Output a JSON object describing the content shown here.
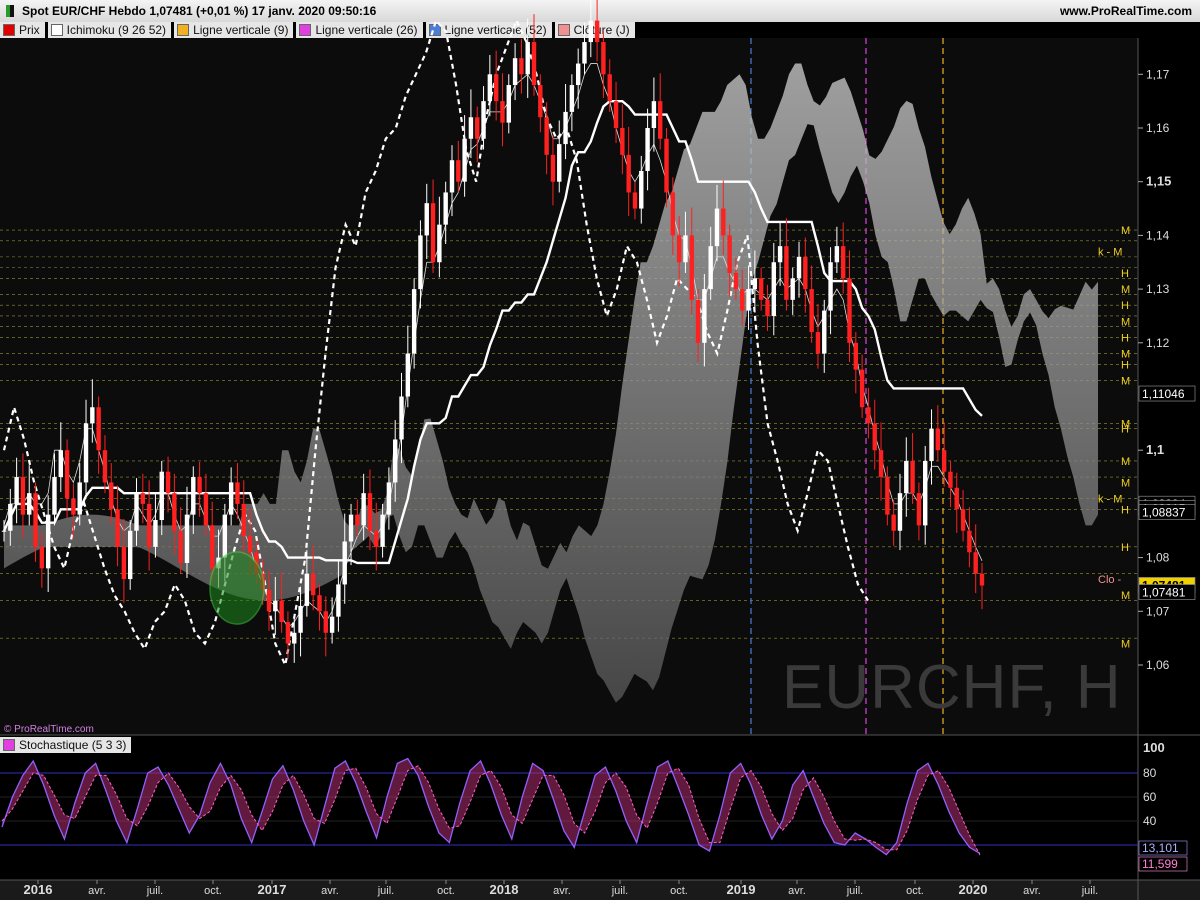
{
  "window": {
    "title": "Spot EUR/CHF Hebdo 1,07481 (+0,01 %) 17 janv. 2020 09:50:16",
    "site": "www.ProRealTime.com",
    "credit": "© ProRealTime.com",
    "watermark": "EURCHF, H"
  },
  "legend": [
    {
      "label": "Prix",
      "color": "#e00000"
    },
    {
      "label": "Ichimoku (9 26 52)",
      "color": "#ffffff"
    },
    {
      "label": "Ligne verticale (9)",
      "color": "#f0b020"
    },
    {
      "label": "Ligne verticale (26)",
      "color": "#e040e0"
    },
    {
      "label": "Ligne verticale (52)",
      "color": "#4a7fd8"
    },
    {
      "label": "Clôture (J)",
      "color": "#f09090"
    }
  ],
  "stoch_legend": {
    "label": "Stochastique (5 3 3)",
    "color": "#e040e0"
  },
  "chart_data": [
    {
      "type": "line",
      "title": "",
      "x": [
        "2016",
        "avr.",
        "juil.",
        "oct.",
        "2017",
        "avr.",
        "juil.",
        "oct.",
        "2018",
        "avr.",
        "juil.",
        "oct.",
        "2019",
        "avr.",
        "juil.",
        "oct.",
        "2020",
        "avr.",
        "juil."
      ],
      "ylim": [
        1.05,
        1.18
      ],
      "yticks": [
        "1,17",
        "1,16",
        "1,15",
        "1,14",
        "1,13",
        "1,12",
        "1,11046",
        "1,1",
        "1,08994",
        "1,08915",
        "1,08837",
        "1,08",
        "1,07481",
        "1,07",
        "1,06"
      ],
      "last_price": "1,07481",
      "series": [
        {
          "name": "Prix",
          "values": [
            1.085,
            1.09,
            1.095,
            1.088,
            1.092,
            1.082,
            1.078,
            1.088,
            1.095,
            1.1,
            1.091,
            1.088,
            1.094,
            1.105,
            1.108,
            1.1,
            1.094,
            1.089,
            1.082,
            1.076,
            1.085,
            1.092,
            1.09,
            1.082,
            1.087,
            1.096,
            1.092,
            1.085,
            1.079,
            1.088,
            1.095,
            1.092,
            1.086,
            1.078,
            1.08,
            1.088,
            1.094,
            1.09,
            1.084,
            1.081,
            1.077,
            1.074,
            1.07,
            1.072,
            1.068,
            1.064,
            1.066,
            1.071,
            1.077,
            1.073,
            1.07,
            1.066,
            1.069,
            1.075,
            1.083,
            1.088,
            1.086,
            1.092,
            1.085,
            1.082,
            1.088,
            1.094,
            1.102,
            1.11,
            1.118,
            1.13,
            1.14,
            1.146,
            1.135,
            1.142,
            1.148,
            1.154,
            1.15,
            1.158,
            1.162,
            1.158,
            1.165,
            1.17,
            1.165,
            1.161,
            1.168,
            1.173,
            1.17,
            1.176,
            1.168,
            1.162,
            1.155,
            1.15,
            1.157,
            1.163,
            1.168,
            1.172,
            1.176,
            1.18,
            1.176,
            1.17,
            1.165,
            1.16,
            1.155,
            1.148,
            1.145,
            1.152,
            1.16,
            1.165,
            1.158,
            1.148,
            1.14,
            1.135,
            1.14,
            1.128,
            1.12,
            1.13,
            1.138,
            1.145,
            1.14,
            1.133,
            1.13,
            1.126,
            1.13,
            1.132,
            1.128,
            1.125,
            1.135,
            1.138,
            1.128,
            1.132,
            1.136,
            1.13,
            1.122,
            1.118,
            1.126,
            1.135,
            1.138,
            1.132,
            1.12,
            1.115,
            1.108,
            1.105,
            1.1,
            1.095,
            1.088,
            1.085,
            1.092,
            1.098,
            1.092,
            1.086,
            1.098,
            1.104,
            1.1,
            1.096,
            1.093,
            1.089,
            1.085,
            1.081,
            1.077,
            1.0748
          ]
        },
        {
          "name": "Tenkan",
          "values": [
            1.086,
            1.09,
            1.09,
            1.09,
            1.092,
            1.09,
            1.09,
            1.092,
            1.1,
            1.1,
            1.096,
            1.094,
            1.098,
            1.104,
            1.104,
            1.1,
            1.096,
            1.091,
            1.087,
            1.085,
            1.086,
            1.09,
            1.088,
            1.086,
            1.088,
            1.092,
            1.092,
            1.088,
            1.085,
            1.086,
            1.09,
            1.09,
            1.087,
            1.084,
            1.084,
            1.087,
            1.09,
            1.088,
            1.085,
            1.082,
            1.078,
            1.075,
            1.072,
            1.071,
            1.069,
            1.067,
            1.068,
            1.07,
            1.072,
            1.071,
            1.07,
            1.068,
            1.07,
            1.074,
            1.078,
            1.081,
            1.084,
            1.086,
            1.085,
            1.084,
            1.086,
            1.09,
            1.096,
            1.103,
            1.112,
            1.12,
            1.128,
            1.135,
            1.135,
            1.138,
            1.142,
            1.146,
            1.148,
            1.152,
            1.156,
            1.157,
            1.16,
            1.163,
            1.163,
            1.163,
            1.165,
            1.168,
            1.169,
            1.17,
            1.168,
            1.165,
            1.162,
            1.158,
            1.158,
            1.16,
            1.163,
            1.166,
            1.17,
            1.172,
            1.172,
            1.168,
            1.165,
            1.16,
            1.156,
            1.152,
            1.15,
            1.152,
            1.155,
            1.157,
            1.154,
            1.15,
            1.144,
            1.14,
            1.139,
            1.134,
            1.128,
            1.128,
            1.132,
            1.136,
            1.136,
            1.133,
            1.131,
            1.129,
            1.13,
            1.13,
            1.129,
            1.128,
            1.13,
            1.132,
            1.13,
            1.131,
            1.132,
            1.13,
            1.126,
            1.123,
            1.125,
            1.128,
            1.13,
            1.128,
            1.122,
            1.118,
            1.112,
            1.108,
            1.103,
            1.099,
            1.094,
            1.09,
            1.09,
            1.092,
            1.092,
            1.09,
            1.093,
            1.097,
            1.097,
            1.095,
            1.093,
            1.091,
            1.088,
            1.085,
            1.082,
            1.0794
          ]
        },
        {
          "name": "Chikou",
          "values": [
            1.1,
            1.108,
            1.102,
            1.094,
            1.088,
            1.082,
            1.078,
            1.086,
            1.09,
            1.084,
            1.078,
            1.073,
            1.07,
            1.066,
            1.063,
            1.068,
            1.07,
            1.075,
            1.072,
            1.066,
            1.064,
            1.068,
            1.075,
            1.082,
            1.088,
            1.085,
            1.075,
            1.064,
            1.06,
            1.07,
            1.08,
            1.1,
            1.118,
            1.134,
            1.142,
            1.138,
            1.148,
            1.152,
            1.158,
            1.16,
            1.166,
            1.17,
            1.174,
            1.18,
            1.178,
            1.168,
            1.156,
            1.15,
            1.162,
            1.17,
            1.175,
            1.18,
            1.176,
            1.17,
            1.162,
            1.158,
            1.16,
            1.154,
            1.142,
            1.132,
            1.125,
            1.13,
            1.138,
            1.135,
            1.128,
            1.12,
            1.125,
            1.132,
            1.13,
            1.128,
            1.122,
            1.118,
            1.126,
            1.135,
            1.14,
            1.12,
            1.105,
            1.098,
            1.09,
            1.085,
            1.092,
            1.1,
            1.098,
            1.09,
            1.082,
            1.075,
            1.072
          ]
        }
      ]
    },
    {
      "type": "line",
      "title": "",
      "ylim": [
        0,
        100
      ],
      "yticks": [
        "100",
        "80",
        "60",
        "40"
      ],
      "last_values": [
        "13,101",
        "11,599"
      ],
      "series": [
        {
          "name": "%K",
          "values": [
            35,
            60,
            78,
            90,
            70,
            45,
            25,
            55,
            80,
            88,
            65,
            40,
            22,
            50,
            80,
            85,
            70,
            50,
            30,
            45,
            72,
            88,
            70,
            42,
            22,
            48,
            75,
            86,
            66,
            40,
            20,
            52,
            84,
            90,
            72,
            48,
            26,
            60,
            88,
            92,
            78,
            52,
            30,
            22,
            55,
            82,
            90,
            70,
            45,
            25,
            60,
            88,
            82,
            58,
            32,
            18,
            48,
            78,
            85,
            65,
            40,
            22,
            55,
            85,
            90,
            68,
            45,
            20,
            15,
            45,
            80,
            88,
            70,
            45,
            25,
            40,
            70,
            82,
            60,
            38,
            22,
            20,
            30,
            25,
            18,
            12,
            22,
            55,
            82,
            88,
            70,
            48,
            30,
            18,
            13
          ]
        },
        {
          "name": "%D",
          "values": [
            40,
            50,
            65,
            80,
            78,
            62,
            45,
            42,
            60,
            78,
            78,
            62,
            42,
            36,
            52,
            72,
            80,
            68,
            52,
            42,
            48,
            68,
            78,
            66,
            45,
            32,
            48,
            70,
            78,
            62,
            42,
            38,
            58,
            82,
            84,
            68,
            46,
            38,
            60,
            82,
            86,
            72,
            50,
            34,
            36,
            56,
            78,
            82,
            68,
            45,
            38,
            58,
            78,
            78,
            62,
            38,
            30,
            48,
            72,
            80,
            68,
            45,
            34,
            55,
            80,
            84,
            70,
            42,
            22,
            22,
            50,
            76,
            82,
            68,
            46,
            32,
            42,
            66,
            76,
            60,
            40,
            25,
            24,
            25,
            22,
            16,
            16,
            32,
            58,
            78,
            82,
            68,
            48,
            28,
            11.6
          ]
        }
      ]
    }
  ]
}
